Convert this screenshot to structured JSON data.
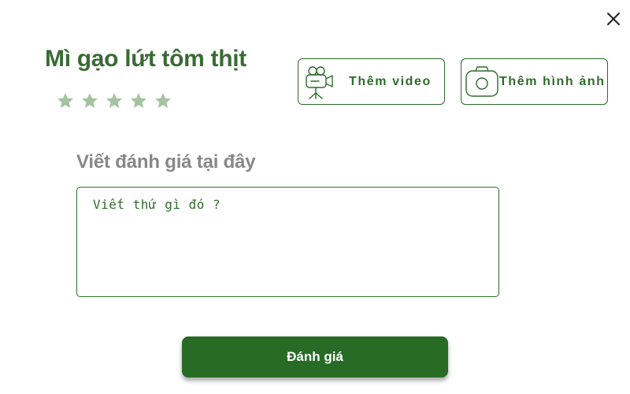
{
  "dialog": {
    "product_name": "Mì gạo lứt tôm thịt",
    "rating": {
      "max": 5,
      "selected": 0,
      "star_color": "#a3c49f"
    },
    "media_buttons": {
      "video": {
        "label": "Thêm video",
        "icon": "video-camera-icon"
      },
      "photo": {
        "label": "Thêm hình ảnh",
        "icon": "camera-icon"
      }
    },
    "review": {
      "heading": "Viết đánh giá tại đây",
      "placeholder": "Viết thứ gì đó ?",
      "value": ""
    },
    "submit_label": "Đánh giá",
    "close_icon": "close-icon"
  },
  "colors": {
    "primary_green": "#276b24",
    "title_green": "#3a6b35",
    "heading_gray": "#888888",
    "star_green": "#a3c49f"
  }
}
